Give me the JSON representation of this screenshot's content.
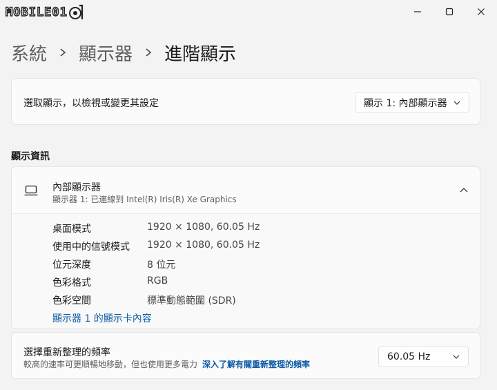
{
  "watermark": {
    "text": "MOBILE01"
  },
  "window_controls": {
    "minimize": "minimize",
    "maximize": "maximize",
    "close": "close"
  },
  "breadcrumb": {
    "items": [
      "系統",
      "顯示器",
      "進階顯示"
    ]
  },
  "display_select": {
    "label": "選取顯示，以檢視或變更其設定",
    "value": "顯示 1: 內部顯示器"
  },
  "display_info": {
    "section_title": "顯示資訊",
    "title": "內部顯示器",
    "subtitle": "顯示器 1: 已連線到 Intel(R) Iris(R) Xe Graphics",
    "rows": [
      {
        "key": "桌面模式",
        "value": "1920 × 1080, 60.05 Hz"
      },
      {
        "key": "使用中的信號模式",
        "value": "1920 × 1080, 60.05 Hz"
      },
      {
        "key": "位元深度",
        "value": "8 位元"
      },
      {
        "key": "色彩格式",
        "value": "RGB"
      },
      {
        "key": "色彩空間",
        "value": "標準動態範圍 (SDR)"
      }
    ],
    "adapter_link": "顯示器 1 的顯示卡內容",
    "expanded": true
  },
  "refresh_rate": {
    "title": "選擇重新整理的頻率",
    "description": "較高的速率可更順暢地移動，但也使用更多電力",
    "link": "深入了解有關重新整理的頻率",
    "value": "60.05 Hz"
  },
  "colors": {
    "background": "#f3f3f3",
    "card": "#fbfbfb",
    "link": "#0c5aa6"
  }
}
